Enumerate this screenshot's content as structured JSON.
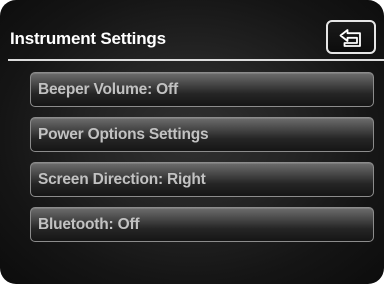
{
  "header": {
    "title": "Instrument Settings",
    "back_icon": "back-arrow-icon"
  },
  "menu": {
    "items": [
      {
        "label": "Beeper Volume: Off"
      },
      {
        "label": "Power Options Settings"
      },
      {
        "label": "Screen Direction: Right"
      },
      {
        "label": "Bluetooth: Off"
      }
    ]
  },
  "colors": {
    "background": "#1e1e1e",
    "title_text": "#ffffff",
    "item_text": "#c2c2c2",
    "item_border": "#8c8c8c",
    "divider": "#dcdcdc"
  }
}
